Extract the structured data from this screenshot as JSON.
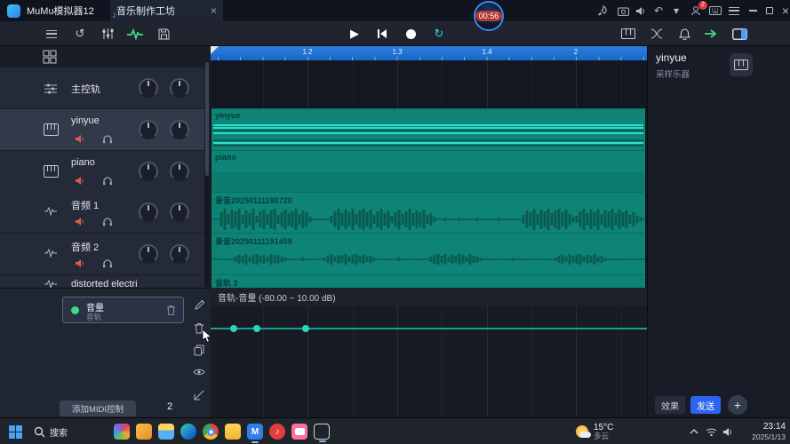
{
  "colors": {
    "accent_blue": "#2f7fe8",
    "ruler_blue": "#1a66c6",
    "clip_teal": "#0e8477",
    "note_bright": "#2be0c8",
    "send_blue": "#2e63f2",
    "mute_red": "#e25c4e",
    "green": "#3ddc84",
    "record_white": "#ffffff"
  },
  "icons": {
    "music_note": "♪",
    "close": "×",
    "play": "▶",
    "undo": "↺",
    "loop": "↻",
    "back": "↶",
    "chevron_down": "▾",
    "plus": "+",
    "mumu_letter": "M",
    "app_music_note": "♪"
  },
  "titlebar": {
    "app_title": "MuMu模拟器12",
    "tab_title": "音乐制作工坊",
    "timer": "00:56",
    "user_badge": "2"
  },
  "sidebar": {
    "tracks": [
      {
        "name": "主控轨"
      },
      {
        "name": "yinyue"
      },
      {
        "name": "piano"
      },
      {
        "name": "音频 1"
      },
      {
        "name": "音频 2"
      },
      {
        "name": "distorted  electri"
      }
    ]
  },
  "ruler": {
    "labels": [
      "1.2",
      "1.3",
      "1.4",
      "2"
    ]
  },
  "clips": {
    "yinyue": "yinyue",
    "piano": "piano",
    "rec1": "录音20250111190720",
    "rec2": "录音20250111191459",
    "track3": "音轨 3"
  },
  "automation": {
    "lane_title": "音轨-音量  (-80.00 ~ 10.00 dB)",
    "param_name": "音量",
    "param_scope": "音轨",
    "add_midi_button": "添加MIDI控制",
    "page_number": "2"
  },
  "inspector": {
    "title": "yinyue",
    "subtitle": "采样乐器",
    "effects_button": "效果",
    "send_button": "发送"
  },
  "taskbar": {
    "search_label": "搜索",
    "weather_temp": "15°C",
    "weather_cond": "多云",
    "time": "23:14",
    "date": "2025/1/13"
  },
  "waveforms": {
    "rec1": [
      1,
      1,
      8,
      12,
      6,
      11,
      9,
      12,
      5,
      10,
      7,
      12,
      4,
      9,
      11,
      6,
      10,
      12,
      5,
      8,
      11,
      7,
      9,
      12,
      6,
      10,
      8,
      3,
      1,
      1,
      1,
      1,
      1,
      4,
      9,
      12,
      7,
      11,
      8,
      12,
      6,
      10,
      12,
      8,
      11,
      5,
      9,
      12,
      7,
      10,
      4,
      8,
      11,
      6,
      9,
      12,
      7,
      10,
      8,
      11,
      5,
      7,
      3,
      1,
      1,
      2,
      1,
      1,
      1,
      2,
      1,
      1,
      1,
      1,
      2,
      1,
      1,
      1,
      1,
      1,
      2,
      1,
      1,
      1,
      1,
      1,
      1,
      5,
      10,
      8,
      12,
      6,
      11,
      9,
      12,
      7,
      10,
      12,
      8,
      11,
      6,
      3,
      4,
      9,
      12,
      7,
      11,
      8,
      12,
      6,
      10,
      9,
      12,
      7,
      11,
      8,
      10,
      5,
      8,
      4,
      2,
      1
    ],
    "rec2": [
      1,
      1,
      1,
      1,
      1,
      1,
      3,
      5,
      4,
      6,
      3,
      5,
      6,
      4,
      5,
      3,
      6,
      4,
      5,
      3,
      2,
      1,
      1,
      1,
      1,
      2,
      1,
      1,
      1,
      1,
      1,
      2,
      4,
      6,
      3,
      5,
      4,
      6,
      3,
      5,
      6,
      4,
      5,
      3,
      4,
      2,
      1,
      1,
      1,
      1,
      1,
      1,
      2,
      1,
      1,
      1,
      1,
      1,
      1,
      1,
      1,
      3,
      5,
      6,
      4,
      6,
      3,
      5,
      4,
      6,
      5,
      3,
      6,
      4,
      3,
      2,
      1,
      1,
      1,
      1,
      1,
      1,
      1,
      1,
      2,
      1,
      1,
      1,
      1,
      1,
      1,
      1,
      1,
      1,
      1,
      1,
      2,
      4,
      5,
      3,
      6,
      4,
      5,
      6,
      3,
      5,
      4,
      6,
      3,
      4,
      2,
      1,
      1,
      1,
      1,
      1,
      1,
      1,
      1,
      1,
      1,
      1
    ]
  }
}
